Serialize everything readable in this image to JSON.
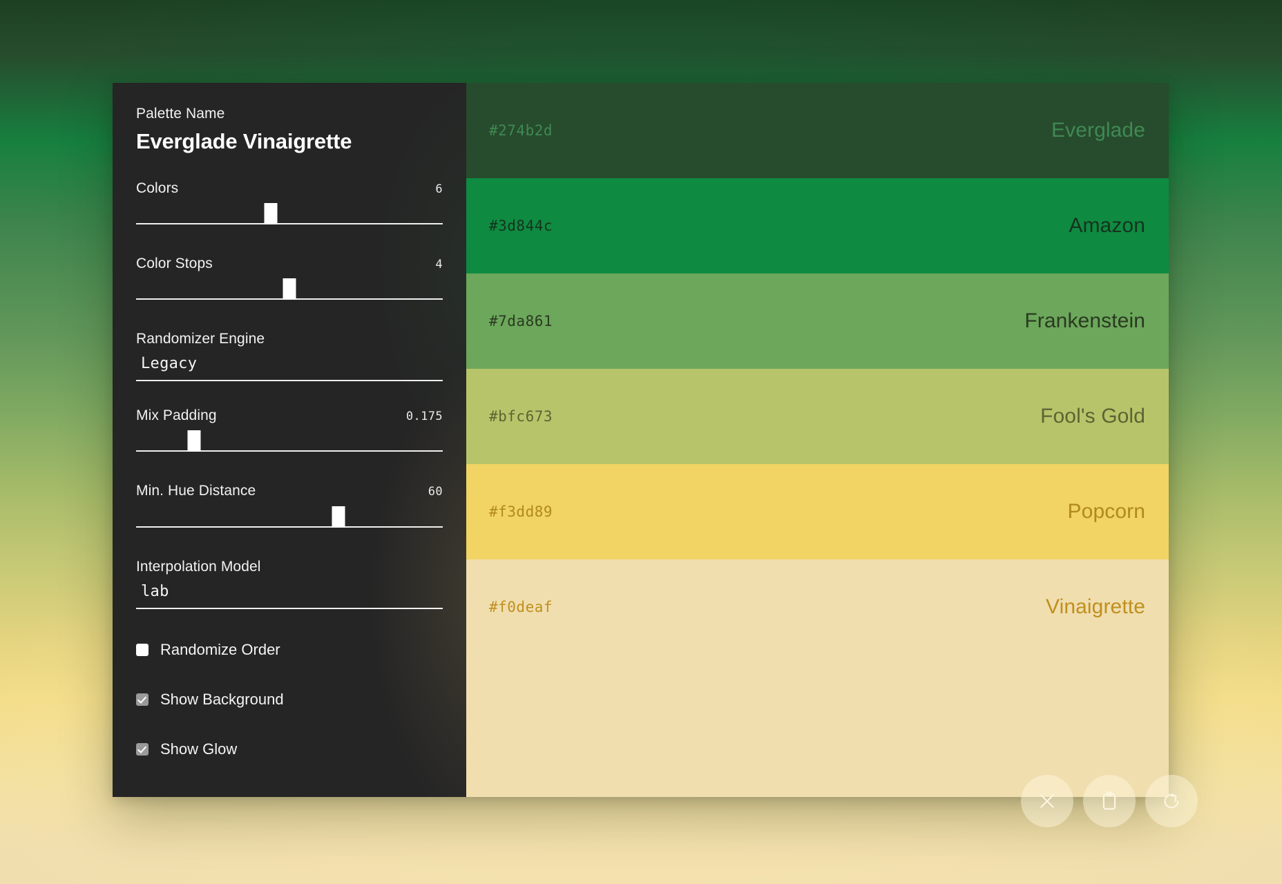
{
  "background": {
    "gradient_stops": [
      "#274b2d",
      "#3d844c",
      "#7da861",
      "#bfc673",
      "#f3dd89",
      "#f0deaf"
    ]
  },
  "panel": {
    "palette_name_label": "Palette Name",
    "palette_name_value": "Everglade Vinaigrette",
    "sliders": [
      {
        "label": "Colors",
        "value": "6",
        "percent": 44
      },
      {
        "label": "Color Stops",
        "value": "4",
        "percent": 50
      },
      {
        "label": "Mix Padding",
        "value": "0.175",
        "percent": 19
      },
      {
        "label": "Min. Hue Distance",
        "value": "60",
        "percent": 66
      }
    ],
    "selects": [
      {
        "label": "Randomizer Engine",
        "value": "Legacy"
      },
      {
        "label": "Interpolation Model",
        "value": "lab"
      }
    ],
    "checkboxes": [
      {
        "label": "Randomize Order",
        "checked": false
      },
      {
        "label": "Show Background",
        "checked": true
      },
      {
        "label": "Show Glow",
        "checked": true
      }
    ]
  },
  "swatches": [
    {
      "hex": "#274b2d",
      "name": "Everglade",
      "text_color": "#3f8a52"
    },
    {
      "hex": "#3d844c",
      "name": "Amazon",
      "text_color": "#14331e"
    },
    {
      "hex": "#7da861",
      "name": "Frankenstein",
      "text_color": "#2a3a20"
    },
    {
      "hex": "#bfc673",
      "name": "Fool's Gold",
      "text_color": "#5d6332"
    },
    {
      "hex": "#f3dd89",
      "name": "Popcorn",
      "text_color": "#b08a1b"
    },
    {
      "hex": "#f0deaf",
      "name": "Vinaigrette",
      "text_color": "#c08f1d"
    }
  ],
  "actions": [
    {
      "id": "close",
      "icon": "close-icon",
      "label": "Close"
    },
    {
      "id": "clipboard",
      "icon": "clipboard-icon",
      "label": "Copy palette"
    },
    {
      "id": "reset",
      "icon": "refresh-icon",
      "label": "Regenerate"
    }
  ]
}
